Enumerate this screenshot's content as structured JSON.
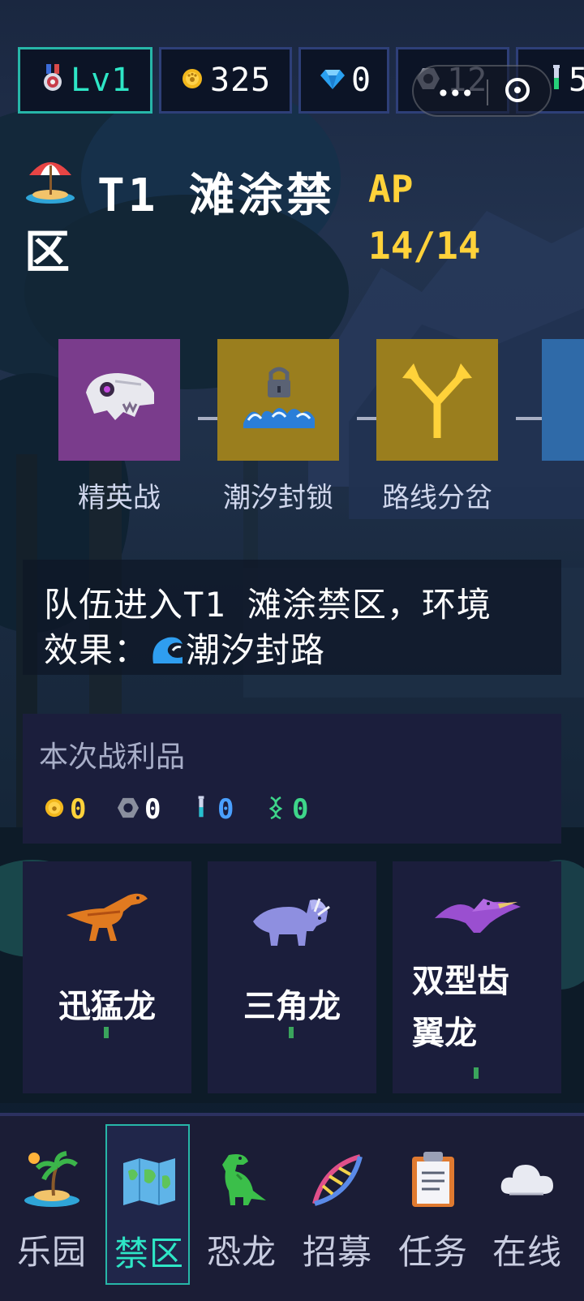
{
  "topbar": {
    "level": "Lv1",
    "gold": "325",
    "gems": "0",
    "bolts": "12",
    "vials": "5"
  },
  "zone": {
    "title": "T1 滩涂禁",
    "title_line2": "区",
    "ap_label": "AP",
    "ap_value": "14/14"
  },
  "route": [
    {
      "label": "精英战",
      "icon": "dino-skull-icon",
      "color": "#7a3c8c"
    },
    {
      "label": "潮汐封锁",
      "icon": "locked-wave-icon",
      "color": "#9a7e1e"
    },
    {
      "label": "路线分岔",
      "icon": "fork-arrow-icon",
      "color": "#9a7e1e"
    },
    {
      "label": "",
      "icon": "unknown-icon",
      "color": "#2f6aa8"
    }
  ],
  "message": {
    "line1": "队伍进入T1 滩涂禁区，环境",
    "line2_prefix": "效果：",
    "line2_effect": "潮汐封路"
  },
  "loot": {
    "title": "本次战利品",
    "items": [
      {
        "icon": "gold-coin-icon",
        "value": "0",
        "color": "#ffd23a"
      },
      {
        "icon": "bolt-nut-icon",
        "value": "0",
        "color": "#ffffff"
      },
      {
        "icon": "vial-icon",
        "value": "0",
        "color": "#4aa0ff"
      },
      {
        "icon": "dna-icon",
        "value": "0",
        "color": "#3ed68a"
      }
    ]
  },
  "dinos": [
    {
      "name": "迅猛龙",
      "icon": "raptor-icon"
    },
    {
      "name": "三角龙",
      "icon": "triceratops-icon"
    },
    {
      "name_line1": "双型齿",
      "name_line2": "翼龙",
      "icon": "pterosaur-icon"
    }
  ],
  "nav": [
    {
      "label": "乐园",
      "icon": "island-icon",
      "active": false
    },
    {
      "label": "禁区",
      "icon": "map-icon",
      "active": true
    },
    {
      "label": "恐龙",
      "icon": "trex-icon",
      "active": false
    },
    {
      "label": "招募",
      "icon": "dna-helix-icon",
      "active": false
    },
    {
      "label": "任务",
      "icon": "clipboard-icon",
      "active": false
    },
    {
      "label": "在线",
      "icon": "cloud-icon",
      "active": false
    }
  ]
}
